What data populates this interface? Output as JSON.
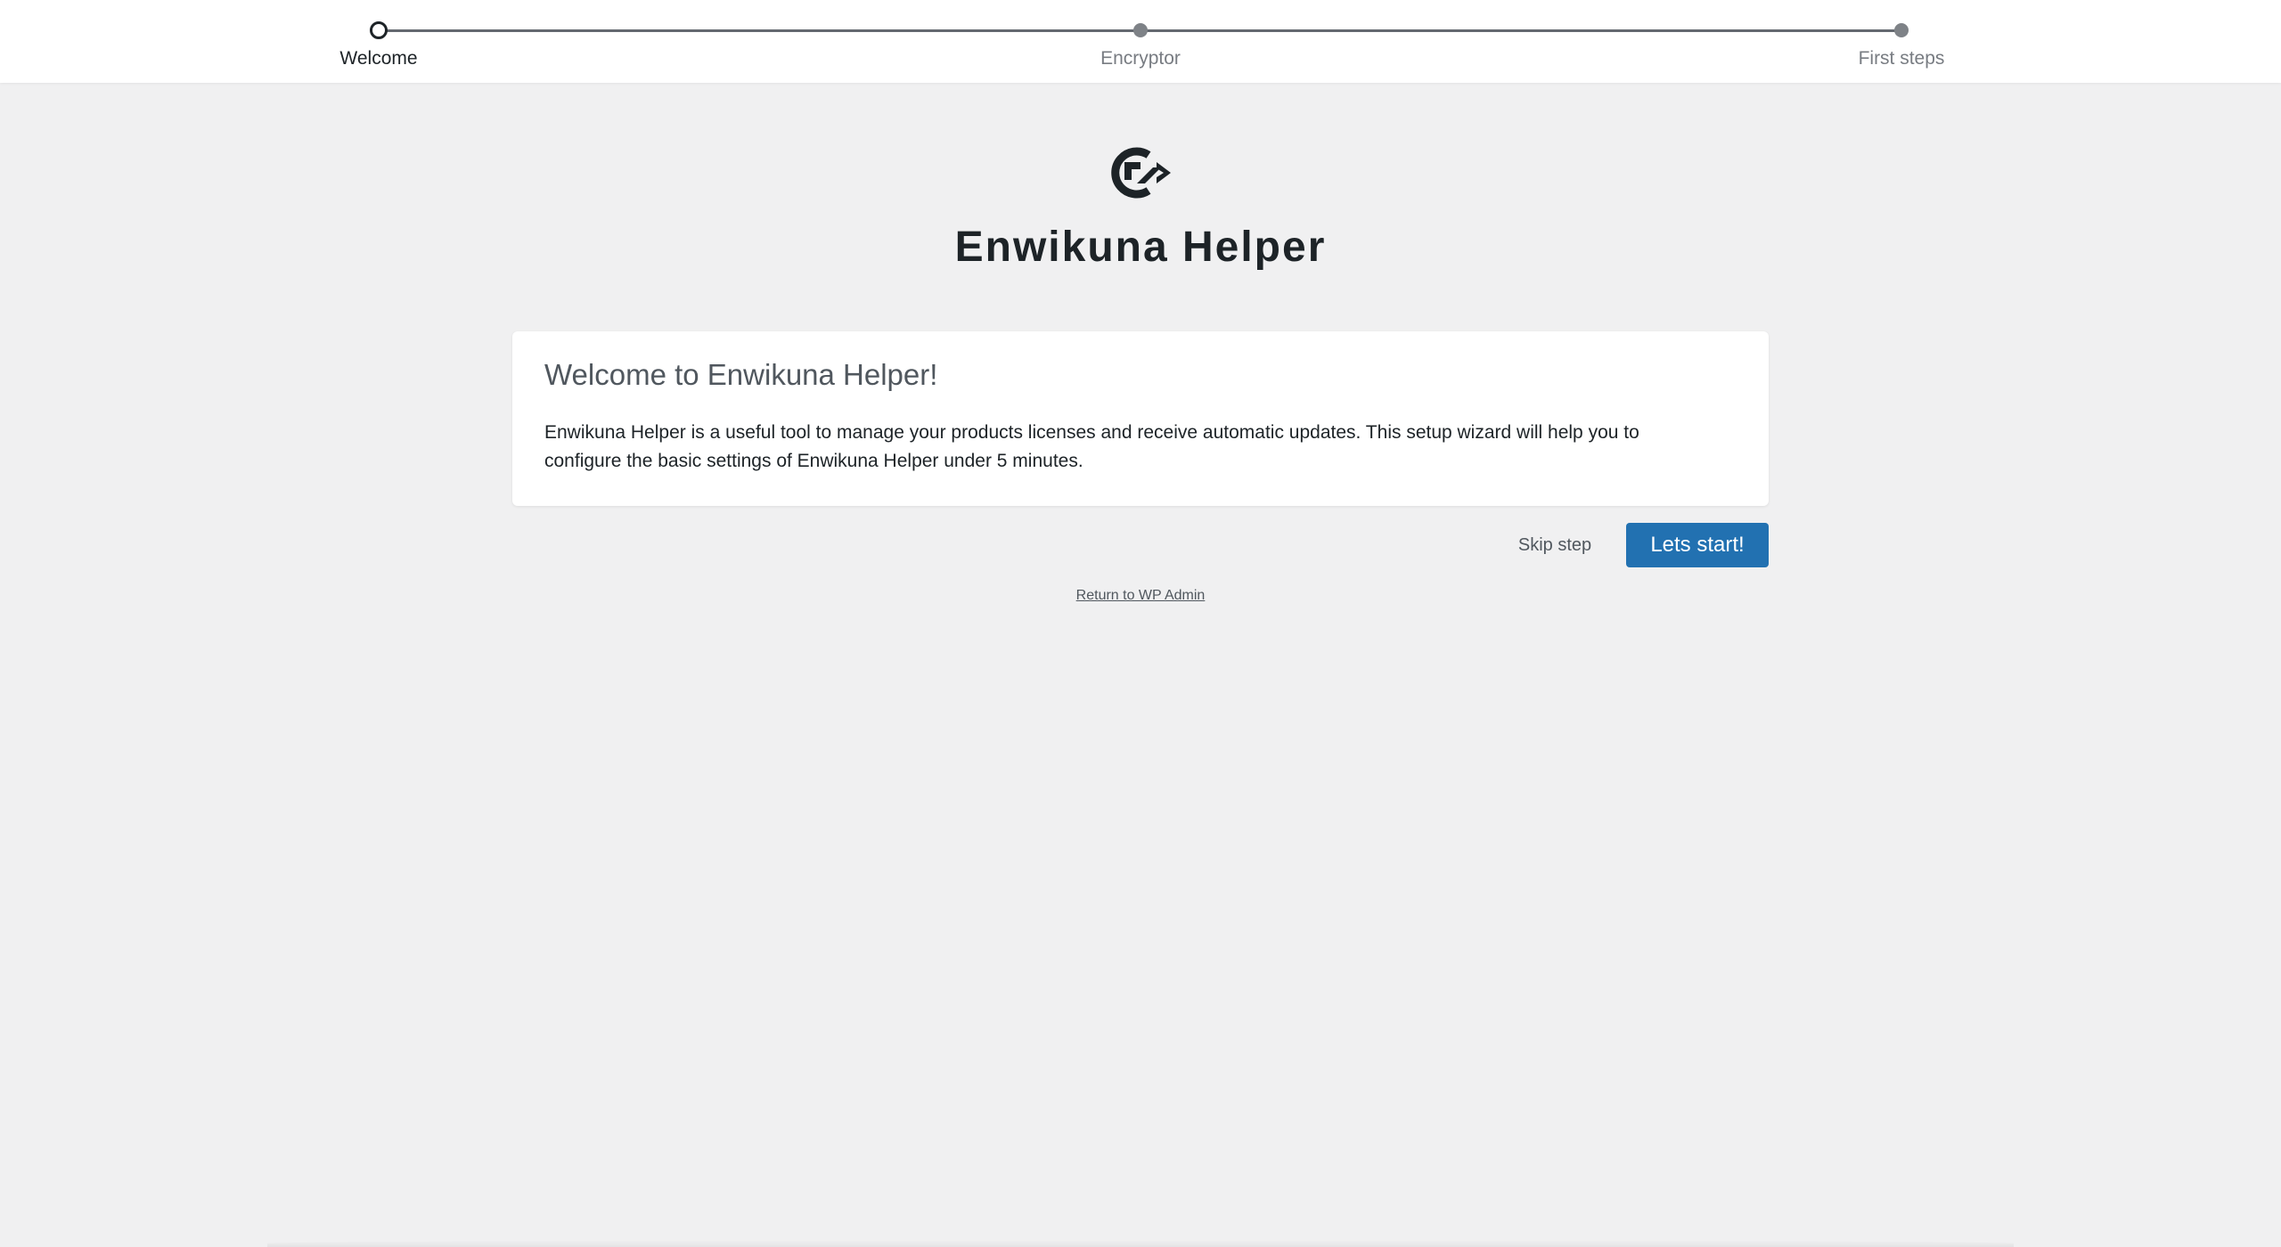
{
  "steps": [
    {
      "label": "Welcome",
      "state": "active"
    },
    {
      "label": "Encryptor",
      "state": "pending"
    },
    {
      "label": "First steps",
      "state": "pending"
    }
  ],
  "brand": {
    "title": "Enwikuna Helper",
    "logo_icon": "enwikuna-logo-icon"
  },
  "card": {
    "title": "Welcome to Enwikuna Helper!",
    "text": "Enwikuna Helper is a useful tool to manage your products licenses and receive automatic updates. This setup wizard will help you to configure the basic settings of Enwikuna Helper under 5 minutes."
  },
  "actions": {
    "skip_label": "Skip step",
    "start_label": "Lets start!",
    "return_label": "Return to WP Admin"
  },
  "colors": {
    "primary": "#2271b1",
    "background": "#f0f0f1",
    "text": "#1d2327"
  }
}
